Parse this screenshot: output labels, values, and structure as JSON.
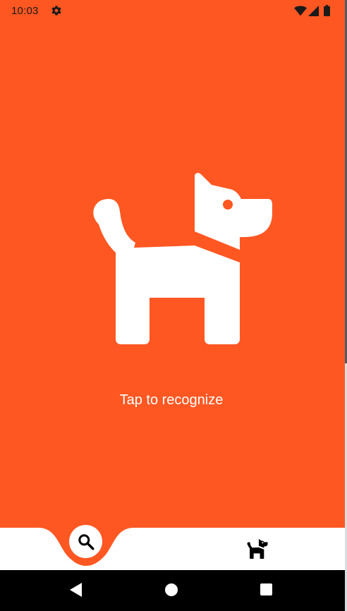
{
  "status_bar": {
    "time": "10:03",
    "icons": [
      "settings-icon",
      "wifi-icon",
      "signal-icon",
      "battery-icon"
    ]
  },
  "main": {
    "illustration": "dog-icon",
    "prompt": "Tap to recognize"
  },
  "bottom_nav": {
    "items": [
      {
        "icon": "search-icon",
        "selected": true
      },
      {
        "icon": "dog-icon",
        "selected": false
      }
    ]
  },
  "system_nav": {
    "buttons": [
      "back",
      "home",
      "recents"
    ]
  },
  "colors": {
    "primary": "#FF5722",
    "nav_background": "#FFFFFF",
    "system_nav": "#000000"
  }
}
